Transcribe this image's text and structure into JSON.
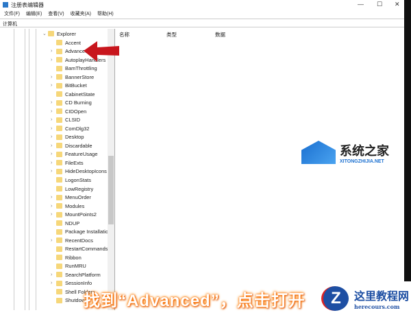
{
  "window": {
    "title": "注册表编辑器",
    "minimize": "—",
    "maximize": "☐",
    "close": "✕"
  },
  "menu": [
    "文件(F)",
    "编辑(E)",
    "查看(V)",
    "收藏夹(A)",
    "帮助(H)"
  ],
  "address": "计算机",
  "tree": {
    "parent": "Explorer",
    "items": [
      {
        "label": "Accent",
        "expandable": false
      },
      {
        "label": "Advanced",
        "expandable": true
      },
      {
        "label": "AutoplayHandlers",
        "expandable": true
      },
      {
        "label": "BamThrottling",
        "expandable": false
      },
      {
        "label": "BannerStore",
        "expandable": true
      },
      {
        "label": "BitBucket",
        "expandable": true
      },
      {
        "label": "CabinetState",
        "expandable": false
      },
      {
        "label": "CD Burning",
        "expandable": true
      },
      {
        "label": "CIDOpen",
        "expandable": true
      },
      {
        "label": "CLSID",
        "expandable": true
      },
      {
        "label": "ComDlg32",
        "expandable": true
      },
      {
        "label": "Desktop",
        "expandable": true
      },
      {
        "label": "Discardable",
        "expandable": true
      },
      {
        "label": "FeatureUsage",
        "expandable": true
      },
      {
        "label": "FileExts",
        "expandable": true
      },
      {
        "label": "HideDesktopIcons",
        "expandable": true
      },
      {
        "label": "LogonStats",
        "expandable": false
      },
      {
        "label": "LowRegistry",
        "expandable": false
      },
      {
        "label": "MenuOrder",
        "expandable": true
      },
      {
        "label": "Modules",
        "expandable": true
      },
      {
        "label": "MountPoints2",
        "expandable": true
      },
      {
        "label": "NDUP",
        "expandable": false
      },
      {
        "label": "Package Installation",
        "expandable": false
      },
      {
        "label": "RecentDocs",
        "expandable": true
      },
      {
        "label": "RestartCommands",
        "expandable": false
      },
      {
        "label": "Ribbon",
        "expandable": false
      },
      {
        "label": "RunMRU",
        "expandable": false
      },
      {
        "label": "SearchPlatform",
        "expandable": true
      },
      {
        "label": "SessionInfo",
        "expandable": true
      },
      {
        "label": "Shell Folders",
        "expandable": false
      },
      {
        "label": "Shutdown",
        "expandable": false
      }
    ]
  },
  "columns": [
    "名称",
    "类型",
    "数据"
  ],
  "watermark": {
    "title": "系统之家",
    "url": "XITONGZHIJIA.NET"
  },
  "caption": "找到“Advanced”，点击打开",
  "badge": {
    "letter": "Z",
    "title": "这里教程网",
    "url": "herecours.com"
  }
}
